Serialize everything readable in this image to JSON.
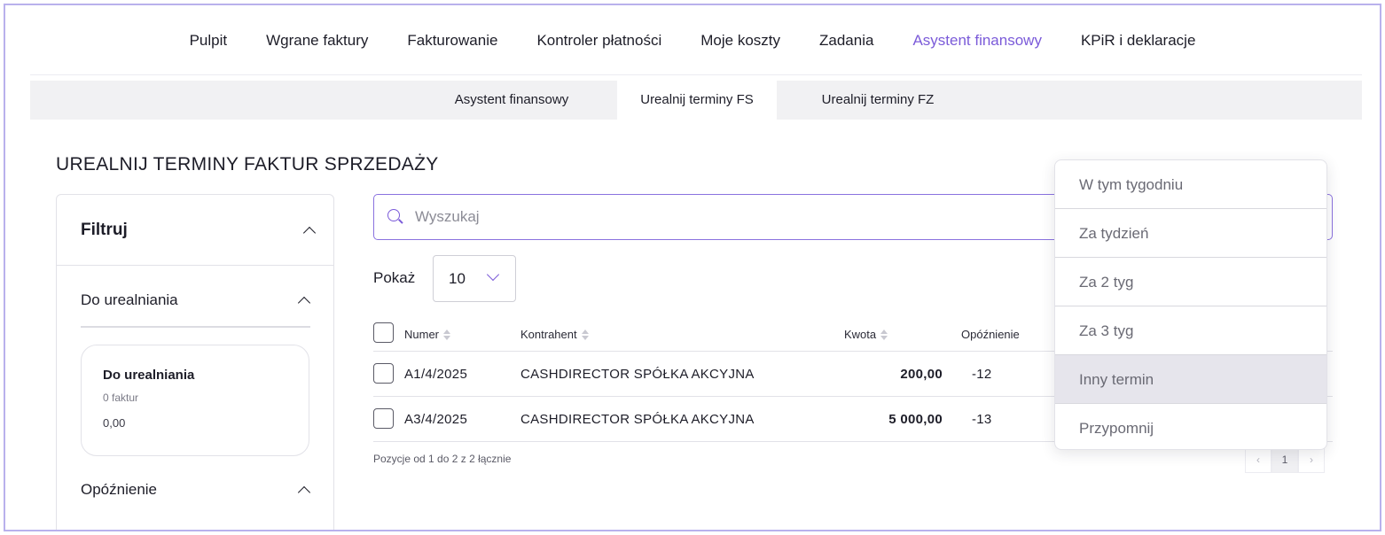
{
  "topnav": {
    "items": [
      {
        "label": "Pulpit"
      },
      {
        "label": "Wgrane faktury"
      },
      {
        "label": "Fakturowanie"
      },
      {
        "label": "Kontroler płatności"
      },
      {
        "label": "Moje koszty"
      },
      {
        "label": "Zadania"
      },
      {
        "label": "Asystent finansowy"
      },
      {
        "label": "KPiR i deklaracje"
      }
    ],
    "active": "Asystent finansowy"
  },
  "subnav": {
    "items": [
      {
        "label": "Asystent finansowy"
      },
      {
        "label": "Urealnij terminy FS"
      },
      {
        "label": "Urealnij terminy FZ"
      }
    ],
    "active": "Urealnij terminy FS"
  },
  "page": {
    "title": "UREALNIJ TERMINY FAKTUR SPRZEDAŻY"
  },
  "filter": {
    "title": "Filtruj",
    "section1": "Do urealniania",
    "card": {
      "title": "Do urealniania",
      "count": "0 faktur",
      "amount": "0,00"
    },
    "section2": "Opóźnienie"
  },
  "search": {
    "placeholder": "Wyszukaj"
  },
  "show": {
    "label": "Pokaż",
    "value": "10"
  },
  "table": {
    "headers": {
      "numer": "Numer",
      "kontrahent": "Kontrahent",
      "kwota": "Kwota",
      "opoznienie": "Opóźnienie"
    },
    "rows": [
      {
        "numer": "A1/4/2025",
        "kontrahent": "CASHDIRECTOR SPÓŁKA AKCYJNA",
        "kwota": "200,00",
        "opoznienie": "-12"
      },
      {
        "numer": "A3/4/2025",
        "kontrahent": "CASHDIRECTOR SPÓŁKA AKCYJNA",
        "kwota": "5 000,00",
        "opoznienie": "-13"
      }
    ],
    "footer": "Pozycje od 1 do 2 z 2 łącznie"
  },
  "pager": {
    "prev": "‹",
    "current": "1",
    "next": "›"
  },
  "dropdown": {
    "items": [
      {
        "label": "W tym tygodniu"
      },
      {
        "label": "Za tydzień"
      },
      {
        "label": "Za 2 tyg"
      },
      {
        "label": "Za 3 tyg"
      },
      {
        "label": "Inny termin"
      },
      {
        "label": "Przypomnij"
      }
    ],
    "highlighted": "Inny termin"
  },
  "colors": {
    "accent": "#7b5bd9",
    "frame": "#b9b1ec",
    "subnav_bg": "#f1f1f3"
  }
}
